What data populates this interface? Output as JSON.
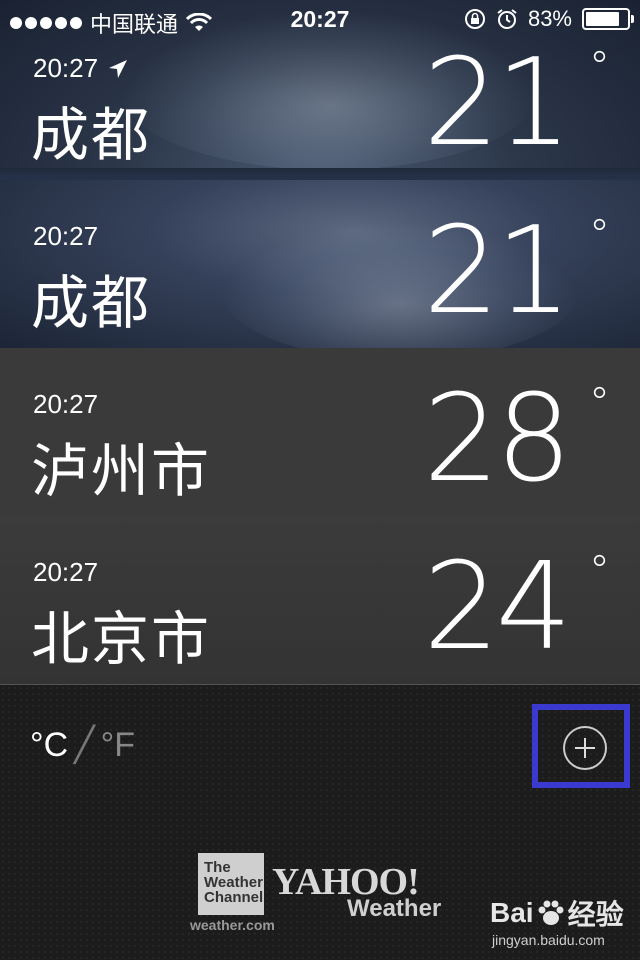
{
  "status_bar": {
    "carrier": "中国联通",
    "time": "20:27",
    "battery_percent": "83%",
    "battery_level": 0.83,
    "icons": [
      "signal-dots-icon",
      "wifi-icon",
      "rotation-lock-icon",
      "alarm-icon",
      "battery-icon"
    ]
  },
  "cities": [
    {
      "local_time": "20:27",
      "name": "成都",
      "temp": "21",
      "deg": "°",
      "is_current_location": true
    },
    {
      "local_time": "20:27",
      "name": "成都",
      "temp": "21",
      "deg": "°",
      "is_current_location": false
    },
    {
      "local_time": "20:27",
      "name": "泸州市",
      "temp": "28",
      "deg": "°",
      "is_current_location": false
    },
    {
      "local_time": "20:27",
      "name": "北京市",
      "temp": "24",
      "deg": "°",
      "is_current_location": false
    }
  ],
  "bottom": {
    "unit_c": "°C",
    "unit_f": "°F",
    "add_icon": "plus-circle-icon",
    "highlight_color": "#3a3ad0"
  },
  "logos": {
    "twc": [
      "The",
      "Weather",
      "Channel"
    ],
    "twc_url": "weather.com",
    "yahoo": "YAHOO!",
    "yahoo_sub": "Weather",
    "baidu": "Bai",
    "baidu_cn": "经验",
    "baidu_url": "jingyan.baidu.com"
  }
}
